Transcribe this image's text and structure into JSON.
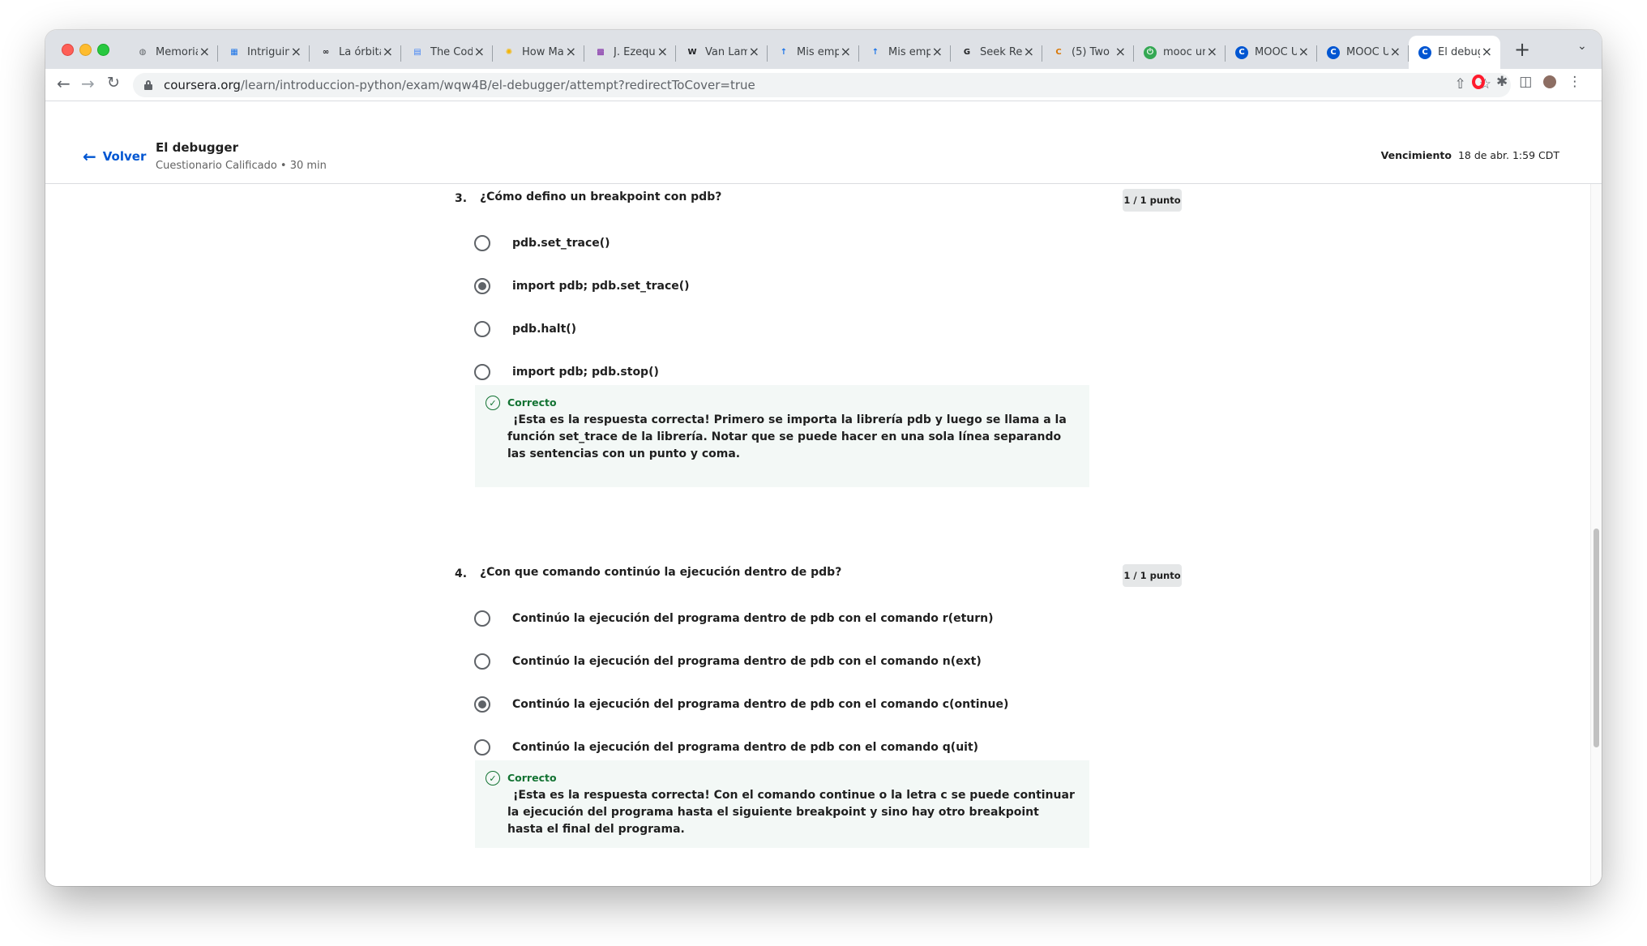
{
  "browser": {
    "tabs": [
      {
        "title": "Memoria",
        "icon": "globe-icon",
        "color": "#5f6368"
      },
      {
        "title": "Intriguin",
        "icon": "calendar-icon",
        "color": "#1a73e8"
      },
      {
        "title": "La órbita",
        "icon": "infinity-icon",
        "color": "#202124"
      },
      {
        "title": "The Cod",
        "icon": "document-icon",
        "color": "#4285f4"
      },
      {
        "title": "How Mar",
        "icon": "sun-icon",
        "color": "#f4b400"
      },
      {
        "title": "J. Ezequ",
        "icon": "image-icon",
        "color": "#7b1fa2"
      },
      {
        "title": "Van Lam",
        "icon": "wikipedia-icon",
        "color": "#202124"
      },
      {
        "title": "Mis emp",
        "icon": "pin-icon",
        "color": "#1a73e8"
      },
      {
        "title": "Mis emp",
        "icon": "pin-icon",
        "color": "#1a73e8"
      },
      {
        "title": "Seek Re",
        "icon": "g-icon",
        "color": "#202124"
      },
      {
        "title": "(5) Two",
        "icon": "c-icon",
        "color": "#d97706"
      },
      {
        "title": "mooc un",
        "icon": "power-icon",
        "color": "#34a853"
      },
      {
        "title": "MOOC U",
        "icon": "coursera-icon",
        "color": "#0056d2"
      },
      {
        "title": "MOOC U",
        "icon": "coursera-icon",
        "color": "#0056d2"
      },
      {
        "title": "El debug",
        "icon": "coursera-icon",
        "color": "#0056d2"
      }
    ],
    "close_glyph": "×",
    "new_tab_glyph": "+",
    "url_host": "coursera.org",
    "url_path": "/learn/introduccion-python/exam/wqw4B/el-debugger/attempt?redirectToCover=true"
  },
  "header": {
    "back_label": "Volver",
    "title": "El debugger",
    "subtitle": "Cuestionario Calificado • 30 min",
    "due_label": "Vencimiento",
    "due_value": "18 de abr. 1:59 CDT"
  },
  "questions": [
    {
      "number": "3.",
      "text": "¿Cómo defino un breakpoint con pdb?",
      "points": "1 / 1 punto",
      "options": [
        {
          "label": "pdb.set_trace()",
          "selected": false
        },
        {
          "label": "import pdb; pdb.set_trace()",
          "selected": true
        },
        {
          "label": "pdb.halt()",
          "selected": false
        },
        {
          "label": "import pdb; pdb.stop()",
          "selected": false
        }
      ],
      "feedback_title": "Correcto",
      "feedback_text": "¡Esta es la respuesta correcta! Primero se importa la librería pdb y luego se llama a la función set_trace de la librería. Notar que se puede hacer en una sola línea separando las sentencias con un punto y coma."
    },
    {
      "number": "4.",
      "text": "¿Con que comando continúo la ejecución dentro de pdb?",
      "points": "1 / 1 punto",
      "options": [
        {
          "label": "Continúo la ejecución del programa dentro de pdb con el comando r(eturn)",
          "selected": false
        },
        {
          "label": "Continúo la ejecución del programa dentro de pdb con el comando n(ext)",
          "selected": false
        },
        {
          "label": "Continúo la ejecución del programa dentro de pdb con el comando c(ontinue)",
          "selected": true
        },
        {
          "label": "Continúo la ejecución del programa dentro de pdb con el comando q(uit)",
          "selected": false
        }
      ],
      "feedback_title": "Correcto",
      "feedback_text": "¡Esta es la respuesta correcta! Con el comando continue o la letra c se puede continuar la ejecución del programa hasta el siguiente breakpoint y sino hay otro breakpoint hasta el final del programa."
    }
  ],
  "colors": {
    "accent": "#0056d2",
    "correct": "#137333",
    "feedback_bg": "#f3f8f6"
  }
}
